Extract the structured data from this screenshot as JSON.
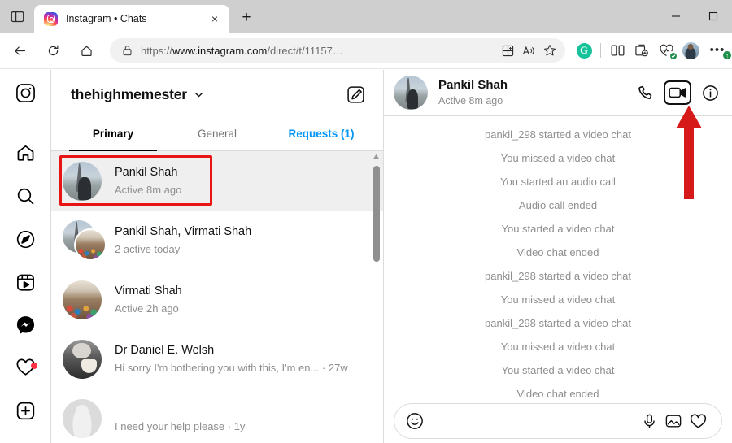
{
  "browser": {
    "tab": {
      "title": "Instagram • Chats",
      "favicon": "instagram-icon",
      "close": "×"
    },
    "newtab_label": "+",
    "window_controls": {
      "minimize": "—",
      "maximize": "▢"
    },
    "toolbar": {
      "back": "←",
      "refresh": "⟳",
      "home": "⌂",
      "url_scheme": "https://",
      "url_domain": "www.instagram.com",
      "url_path": "/direct/t/11157…",
      "lock": "lock-icon",
      "split_screen": "split-screen-icon",
      "collections": "collections-icon",
      "read_aloud": "read-aloud-icon",
      "favorite": "star-icon",
      "grammarly": "G",
      "shopping": "shopping-icon",
      "profile": "profile-avatar",
      "settings_more": "•••",
      "settings_badge": "↑"
    }
  },
  "instagram_nav": {
    "items": [
      {
        "icon": "instagram-logo-icon",
        "label": "Instagram"
      },
      {
        "icon": "home-icon",
        "label": "Home"
      },
      {
        "icon": "search-icon",
        "label": "Search"
      },
      {
        "icon": "explore-compass-icon",
        "label": "Explore"
      },
      {
        "icon": "reels-icon",
        "label": "Reels"
      },
      {
        "icon": "messenger-icon",
        "label": "Messages"
      },
      {
        "icon": "heart-icon",
        "label": "Notifications",
        "badge": true
      },
      {
        "icon": "create-plus-icon",
        "label": "Create"
      }
    ]
  },
  "chat_list": {
    "username": "thehighmemester",
    "chevron": "⌄",
    "compose_icon": "compose-icon",
    "tabs": [
      {
        "label": "Primary",
        "active": true
      },
      {
        "label": "General",
        "active": false
      },
      {
        "label": "Requests (1)",
        "active": false,
        "link": true
      }
    ],
    "items": [
      {
        "name": "Pankil Shah",
        "sub": "Active 8m ago",
        "selected": true,
        "avatar": "paris"
      },
      {
        "name": "Pankil Shah, Virmati Shah",
        "sub": "2 active today",
        "selected": false,
        "avatar": "group"
      },
      {
        "name": "Virmati Shah",
        "sub": "Active 2h ago",
        "selected": false,
        "avatar": "crowd"
      },
      {
        "name": "Dr Daniel E. Welsh",
        "sub": "Hi sorry I'm bothering you with this, I'm en...  · 27w",
        "selected": false,
        "avatar": "mono"
      },
      {
        "name": "",
        "sub": "I need your help please · 1y",
        "selected": false,
        "avatar": "blank"
      }
    ]
  },
  "conversation": {
    "header": {
      "name": "Pankil Shah",
      "status": "Active 8m ago",
      "audio_call_icon": "phone-icon",
      "video_call_icon": "video-camera-icon",
      "info_icon": "info-icon"
    },
    "messages": [
      "pankil_298 started a video chat",
      "You missed a video chat",
      "You started an audio call",
      "Audio call ended",
      "You started a video chat",
      "Video chat ended",
      "pankil_298 started a video chat",
      "You missed a video chat",
      "pankil_298 started a video chat",
      "You missed a video chat",
      "You started a video chat",
      "Video chat ended"
    ],
    "composer": {
      "emoji_icon": "emoji-smiley-icon",
      "placeholder": "",
      "mic_icon": "microphone-icon",
      "gallery_icon": "gallery-icon",
      "like_icon": "heart-icon"
    }
  },
  "annotations": {
    "highlight_color": "#e81313",
    "arrow_color": "#d61919",
    "highlighted_chat": "Pankil Shah",
    "highlighted_button": "video-camera-icon"
  }
}
